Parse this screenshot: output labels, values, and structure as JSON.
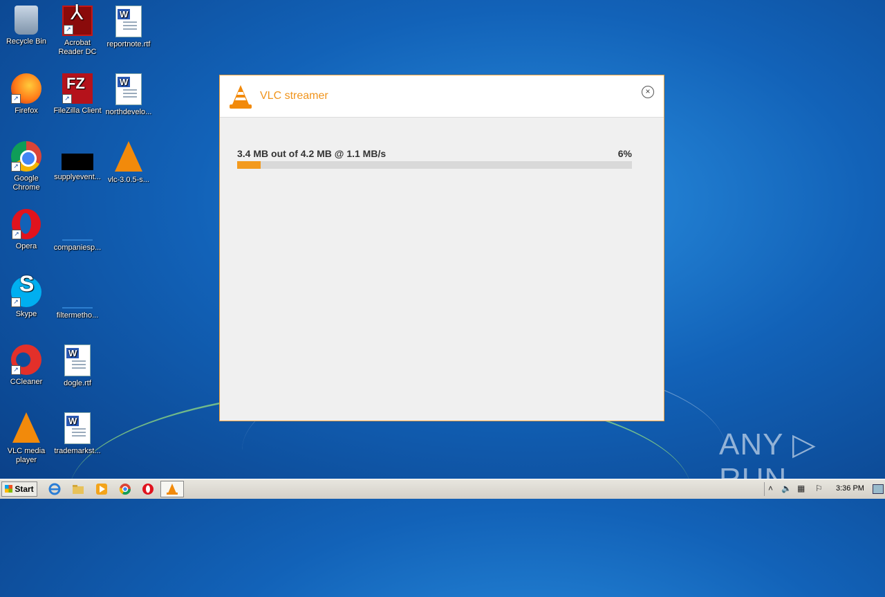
{
  "desktop": {
    "icons": [
      {
        "label": "Recycle Bin"
      },
      {
        "label": "Acrobat Reader DC"
      },
      {
        "label": "reportnote.rtf"
      },
      {
        "label": "Firefox"
      },
      {
        "label": "FileZilla Client"
      },
      {
        "label": "northdevelo..."
      },
      {
        "label": "Google Chrome"
      },
      {
        "label": "supplyevent..."
      },
      {
        "label": "vlc-3.0.5-s..."
      },
      {
        "label": "Opera"
      },
      {
        "label": "companiesp..."
      },
      {
        "label": "Skype"
      },
      {
        "label": "filtermetho..."
      },
      {
        "label": "CCleaner"
      },
      {
        "label": "dogle.rtf"
      },
      {
        "label": "VLC media player"
      },
      {
        "label": "trademarkst..."
      }
    ]
  },
  "dialog": {
    "title": "VLC streamer",
    "close_label": "×",
    "progress_text": "3.4 MB out of 4.2 MB @ 1.1 MB/s",
    "progress_percent_text": "6%",
    "progress_fraction": 0.06,
    "accent_color": "#f39a1e"
  },
  "taskbar": {
    "start_label": "Start",
    "clock": "3:36 PM",
    "tray_icons": [
      "chevron-up-icon",
      "speaker-icon",
      "network-icon",
      "flag-icon"
    ]
  },
  "watermark": "ANY ▷ RUN"
}
